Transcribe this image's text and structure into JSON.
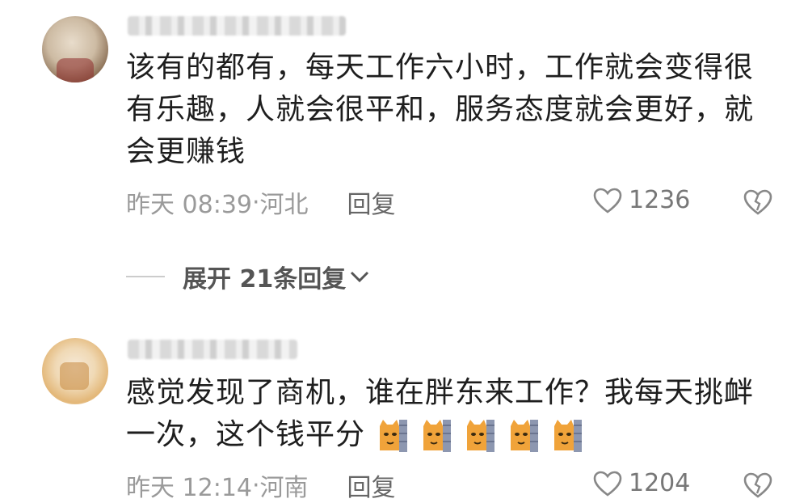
{
  "comments": [
    {
      "text": "该有的都有，每天工作六小时，工作就会变得很有乐趣，人就会很平和，服务态度就会更好，就会更赚钱",
      "time": "昨天 08:39",
      "location": "河北",
      "reply_label": "回复",
      "likes": "1236",
      "expand_label": "展开 21条回复"
    },
    {
      "text": "感觉发现了商机，谁在胖东来工作？我每天挑衅一次，这个钱平分",
      "emoji_count": 5,
      "emoji_name": "cat-peek-emoji",
      "time": "昨天 12:14",
      "location": "河南",
      "reply_label": "回复",
      "likes": "1204"
    }
  ],
  "icons": {
    "like": "heart-outline-icon",
    "dislike": "broken-heart-icon",
    "expand": "chevron-down-icon"
  },
  "colors": {
    "text": "#1e1e1e",
    "meta": "#9a9a9a",
    "emoji": "#f0a33a"
  }
}
